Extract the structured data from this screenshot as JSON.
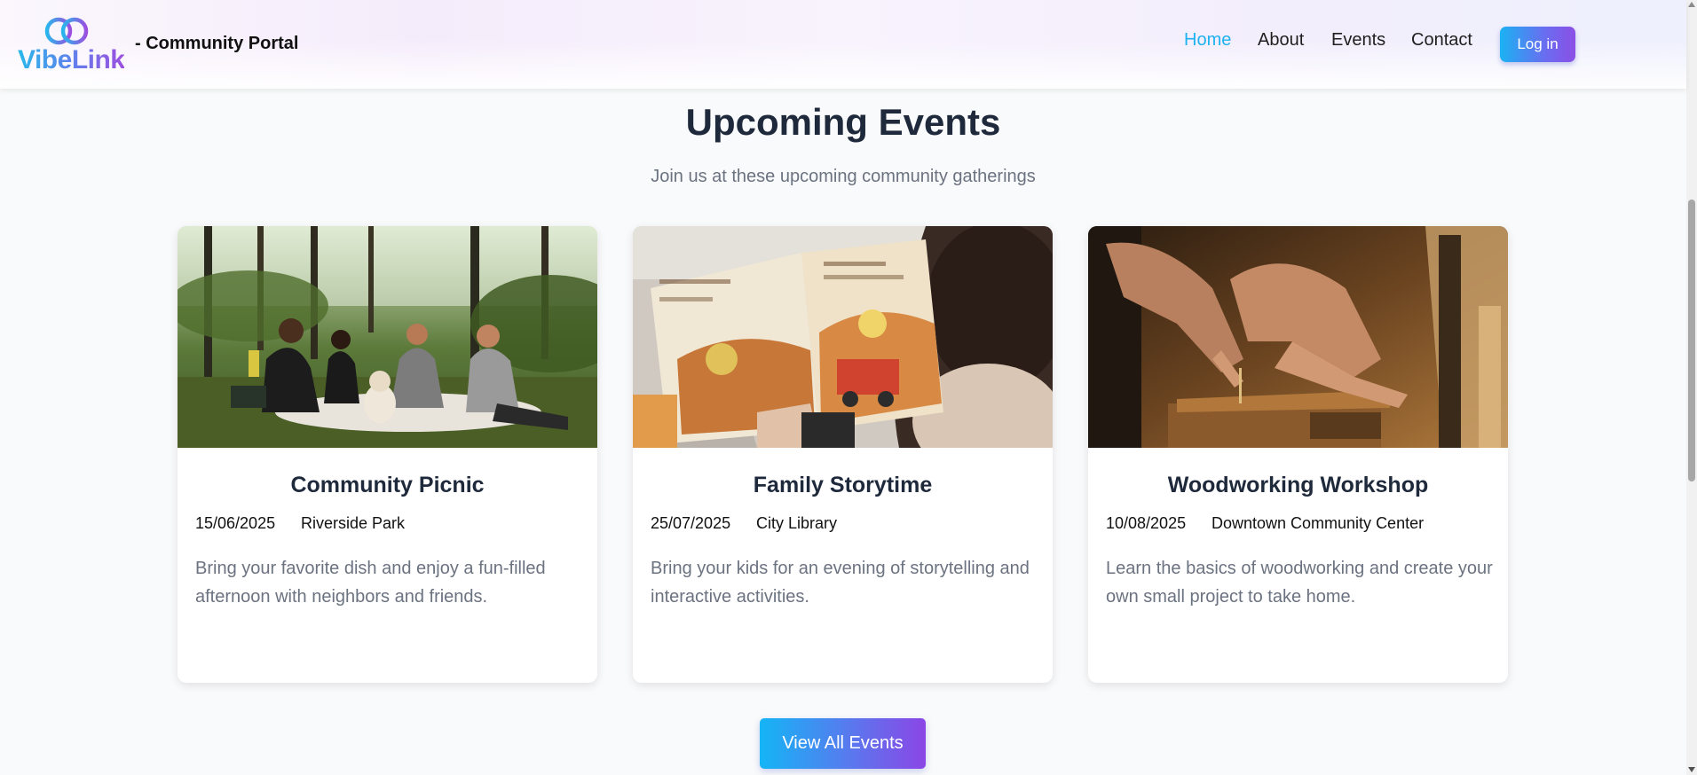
{
  "app": {
    "logo_text": "VibeLink",
    "title": "- Community Portal"
  },
  "nav": {
    "items": [
      {
        "label": "Home",
        "active": true
      },
      {
        "label": "About",
        "active": false
      },
      {
        "label": "Events",
        "active": false
      },
      {
        "label": "Contact",
        "active": false
      }
    ],
    "login_label": "Log in"
  },
  "section": {
    "title": "Upcoming Events",
    "subtitle": "Join us at these upcoming community gatherings"
  },
  "events": [
    {
      "title": "Community Picnic",
      "date": "15/06/2025",
      "location": "Riverside Park",
      "description": "Bring your favorite dish and enjoy a fun-filled afternoon with neighbors and friends."
    },
    {
      "title": "Family Storytime",
      "date": "25/07/2025",
      "location": "City Library",
      "description": "Bring your kids for an evening of storytelling and interactive activities."
    },
    {
      "title": "Woodworking Workshop",
      "date": "10/08/2025",
      "location": "Downtown Community Center",
      "description": "Learn the basics of woodworking and create your own small project to take home."
    }
  ],
  "view_all_label": "View All Events",
  "colors": {
    "accent_blue": "#1fb2f0",
    "accent_purple": "#8b46e6",
    "heading": "#1e293b",
    "muted": "#6b7280"
  }
}
